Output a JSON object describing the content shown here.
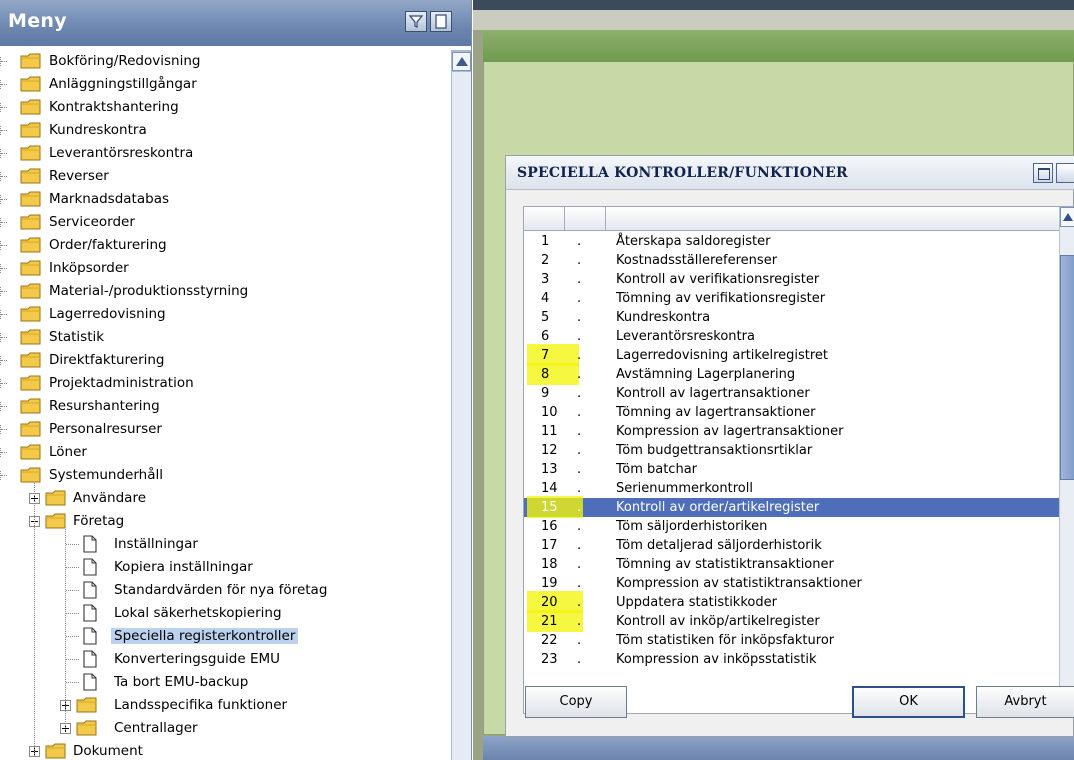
{
  "menu": {
    "title": "Meny",
    "filter_icon": "filter-icon",
    "dock_icon": "dock-icon",
    "items": [
      {
        "label": "Bokföring/Redovisning"
      },
      {
        "label": "Anläggningstillgångar"
      },
      {
        "label": "Kontraktshantering"
      },
      {
        "label": "Kundreskontra"
      },
      {
        "label": "Leverantörsreskontra"
      },
      {
        "label": "Reverser"
      },
      {
        "label": "Marknadsdatabas"
      },
      {
        "label": "Serviceorder"
      },
      {
        "label": "Order/fakturering"
      },
      {
        "label": "Inköpsorder"
      },
      {
        "label": "Material-/produktionsstyrning"
      },
      {
        "label": "Lagerredovisning"
      },
      {
        "label": "Statistik"
      },
      {
        "label": "Direktfakturering"
      },
      {
        "label": "Projektadministration"
      },
      {
        "label": "Resurshantering"
      },
      {
        "label": "Personalresurser"
      },
      {
        "label": "Löner"
      },
      {
        "label": "Systemunderhåll"
      }
    ],
    "system_children": [
      {
        "label": "Användare"
      },
      {
        "label": "Företag"
      }
    ],
    "company_children": [
      {
        "label": "Inställningar"
      },
      {
        "label": "Kopiera inställningar"
      },
      {
        "label": "Standardvärden för nya företag"
      },
      {
        "label": "Lokal säkerhetskopiering"
      },
      {
        "label": "Speciella registerkontroller",
        "selected": true
      },
      {
        "label": "Konverteringsguide EMU"
      },
      {
        "label": "Ta bort EMU-backup"
      }
    ],
    "company_folders": [
      {
        "label": "Landsspecifika funktioner"
      },
      {
        "label": "Centrallager"
      }
    ],
    "partial_item": "Dokument"
  },
  "dialog": {
    "title": "SPECIELLA KONTROLLER/FUNKTIONER",
    "rows": [
      {
        "num": "1",
        "dot": ".",
        "desc": "Återskapa saldoregister"
      },
      {
        "num": "2",
        "dot": ".",
        "desc": "Kostnadsställereferenser"
      },
      {
        "num": "3",
        "dot": ".",
        "desc": "Kontroll av verifikationsregister"
      },
      {
        "num": "4",
        "dot": ".",
        "desc": "Tömning av verifikationsregister"
      },
      {
        "num": "5",
        "dot": ".",
        "desc": "Kundreskontra"
      },
      {
        "num": "6",
        "dot": ".",
        "desc": "Leverantörsreskontra"
      },
      {
        "num": "7",
        "dot": ".",
        "desc": "Lagerredovisning artikelregistret",
        "highlight": true
      },
      {
        "num": "8",
        "dot": ".",
        "desc": "Avstämning Lagerplanering",
        "highlight": true
      },
      {
        "num": "9",
        "dot": ".",
        "desc": "Kontroll av lagertransaktioner"
      },
      {
        "num": "10",
        "dot": ".",
        "desc": "Tömning av lagertransaktioner"
      },
      {
        "num": "11",
        "dot": ".",
        "desc": "Kompression av lagertransaktioner"
      },
      {
        "num": "12",
        "dot": ".",
        "desc": "Töm budgettransaktionsrtiklar"
      },
      {
        "num": "13",
        "dot": ".",
        "desc": "Töm batchar"
      },
      {
        "num": "14",
        "dot": ".",
        "desc": "Serienummerkontroll"
      },
      {
        "num": "15",
        "dot": ".",
        "desc": "Kontroll av order/artikelregister",
        "selected": true,
        "highlight": true
      },
      {
        "num": "16",
        "dot": ".",
        "desc": "Töm säljorderhistoriken"
      },
      {
        "num": "17",
        "dot": ".",
        "desc": "Töm detaljerad säljorderhistorik"
      },
      {
        "num": "18",
        "dot": ".",
        "desc": "Tömning av statistiktransaktioner"
      },
      {
        "num": "19",
        "dot": ".",
        "desc": "Kompression av statistiktransaktioner"
      },
      {
        "num": "20",
        "dot": ".",
        "desc": "Uppdatera statistikkoder",
        "highlight": true
      },
      {
        "num": "21",
        "dot": ".",
        "desc": "Kontroll av inköp/artikelregister",
        "highlight": true
      },
      {
        "num": "22",
        "dot": ".",
        "desc": "Töm statistiken för inköpsfakturor"
      },
      {
        "num": "23",
        "dot": ".",
        "desc": "Kompression av inköpsstatistik"
      }
    ],
    "buttons": {
      "copy": "Copy",
      "ok": "OK",
      "cancel": "Avbryt"
    }
  },
  "colors": {
    "menu_header": "#6f89b2",
    "selection": "#4e6eb9",
    "highlight": "#f3f50b",
    "background_green": "#c7d9a6"
  }
}
